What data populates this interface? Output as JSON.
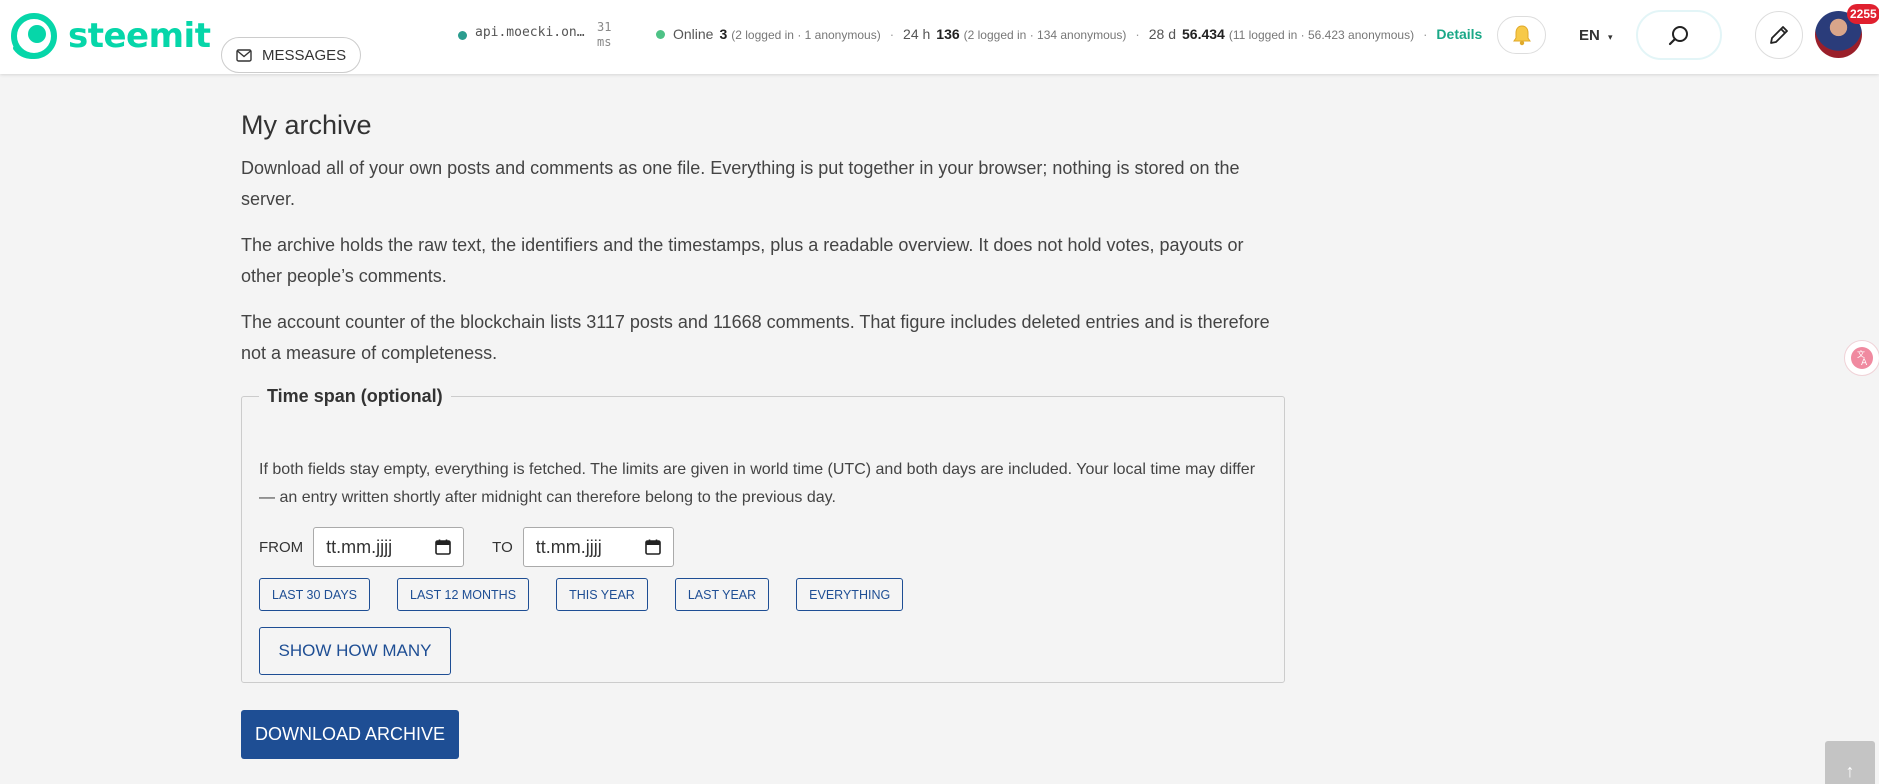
{
  "header": {
    "brand": "steemit",
    "messages_label": "MESSAGES",
    "api_node": "api.moecki.on…",
    "api_latency_value": "31",
    "api_latency_unit": "ms",
    "stats": {
      "online_label": "Online",
      "online_count": "3",
      "online_detail": "(2 logged in · 1 anonymous)",
      "day_label": "24 h",
      "day_count": "136",
      "day_detail": "(2 logged in · 134 anonymous)",
      "month_label": "28 d",
      "month_count": "56.434",
      "month_detail": "(11 logged in · 56.423 anonymous)",
      "separator": "·",
      "details_link": "Details"
    },
    "language": "EN",
    "notification_count": "2255",
    "colors": {
      "brand": "#06d6a9",
      "details": "#1aa887",
      "badge": "#e0202f"
    }
  },
  "main": {
    "title": "My archive",
    "paragraphs": [
      "Download all of your own posts and comments as one file. Everything is put together in your browser; nothing is stored on the server.",
      "The archive holds the raw text, the identifiers and the timestamps, plus a readable overview. It does not hold votes, payouts or other people’s comments.",
      "The account counter of the blockchain lists 3117 posts and 11668 comments. That figure includes deleted entries and is therefore not a measure of completeness."
    ],
    "time_span": {
      "legend": "Time span (optional)",
      "hint": "If both fields stay empty, everything is fetched. The limits are given in world time (UTC) and both days are included. Your local time may differ — an entry written shortly after midnight can therefore belong to the previous day.",
      "from_label": "FROM",
      "from_value": "tt.mm.jjjj",
      "to_label": "TO",
      "to_value": "tt.mm.jjjj",
      "presets": [
        "LAST 30 DAYS",
        "LAST 12 MONTHS",
        "THIS YEAR",
        "LAST YEAR",
        "EVERYTHING"
      ],
      "show_how_many": "SHOW HOW MANY"
    },
    "download_label": "DOWNLOAD ARCHIVE",
    "colors": {
      "primary": "#1e4e94"
    }
  },
  "scroll_top_glyph": "↑"
}
